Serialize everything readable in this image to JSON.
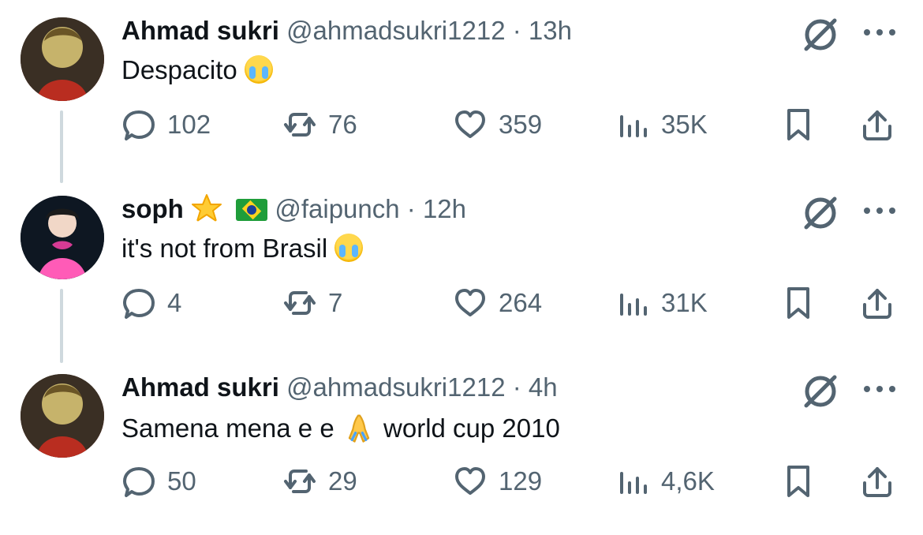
{
  "tweets": [
    {
      "name": "Ahmad sukri",
      "handle": "@ahmadsukri1212",
      "time": "13h",
      "text": "Despacito",
      "metrics": {
        "replies": "102",
        "reposts": "76",
        "likes": "359",
        "views": "35K"
      },
      "icons": {
        "grok": "grok-icon",
        "more": "more-icon"
      }
    },
    {
      "name": "soph",
      "handle": "@faipunch",
      "time": "12h",
      "text": "it's not from Brasil",
      "metrics": {
        "replies": "4",
        "reposts": "7",
        "likes": "264",
        "views": "31K"
      },
      "icons": {
        "grok": "grok-icon",
        "more": "more-icon"
      }
    },
    {
      "name": "Ahmad sukri",
      "handle": "@ahmadsukri1212",
      "time": "4h",
      "text": "Samena mena e e",
      "text_after": " world cup 2010",
      "metrics": {
        "replies": "50",
        "reposts": "29",
        "likes": "129",
        "views": "4,6K"
      },
      "icons": {
        "grok": "grok-icon",
        "more": "more-icon"
      }
    }
  ],
  "ui": {
    "separator": "·",
    "accent_text": "#0f1419",
    "muted_text": "#536471",
    "thread_line": "#cfd9de"
  }
}
